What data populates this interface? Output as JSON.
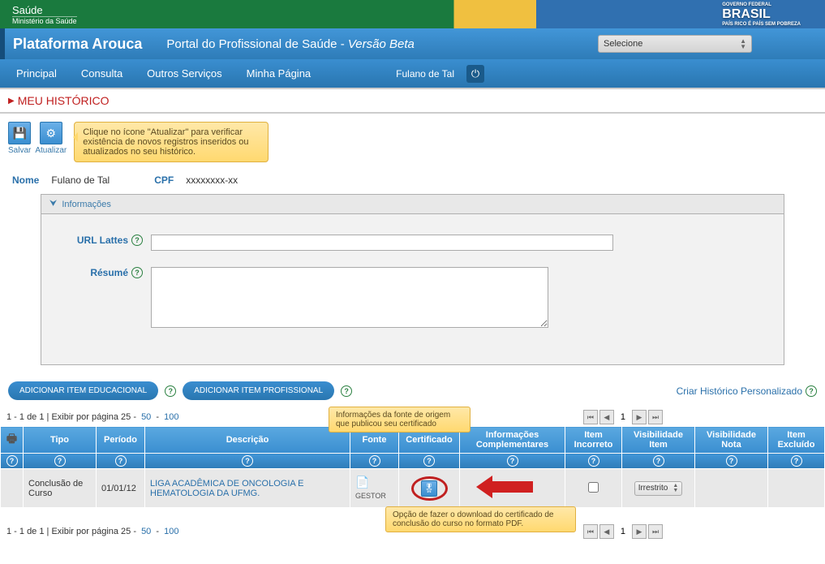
{
  "topbar": {
    "saude": "Saúde",
    "ministry": "Ministério da Saúde",
    "brasil": "BRASIL",
    "brasil_sub1": "GOVERNO FEDERAL",
    "brasil_sub2": "PAÍS RICO É PAÍS SEM POBREZA"
  },
  "header": {
    "platform": "Plataforma Arouca",
    "portal": "Portal do Profissional de Saúde - ",
    "beta": "Versão Beta",
    "selecione": "Selecione"
  },
  "nav": {
    "principal": "Principal",
    "consulta": "Consulta",
    "outros": "Outros Serviços",
    "minha": "Minha Página",
    "username": "Fulano de Tal"
  },
  "page": {
    "title": "MEU HISTÓRICO"
  },
  "toolbar": {
    "salvar": "Salvar",
    "atualizar": "Atualizar",
    "tooltip": "Clique no ícone \"Atualizar\" para verificar existência de novos registros inseridos ou  atualizados no seu histórico."
  },
  "info": {
    "nome_label": "Nome",
    "nome_value": "Fulano de Tal",
    "cpf_label": "CPF",
    "cpf_value": "xxxxxxxx-xx",
    "panel_title": "Informações",
    "url_lattes": "URL Lattes",
    "resume": "Résumé"
  },
  "actions": {
    "educacional": "ADICIONAR ITEM EDUCACIONAL",
    "profissional": "ADICIONAR ITEM PROFISSIONAL",
    "criar_historico": "Criar Histórico Personalizado"
  },
  "pagination": {
    "text": "1 - 1 de 1 | Exibir por página 25 - ",
    "opt50": "50",
    "dash": " - ",
    "opt100": "100",
    "current": "1"
  },
  "tooltips": {
    "fonte": "Informações da fonte de origem que publicou seu certificado",
    "cert": "Opção de fazer o download do certificado de conclusão do curso no formato PDF."
  },
  "table": {
    "headers": {
      "tipo": "Tipo",
      "periodo": "Período",
      "descricao": "Descrição",
      "fonte": "Fonte",
      "certificado": "Certificado",
      "info_comp": "Informações Complementares",
      "item_incorreto": "Item Incorreto",
      "vis_item": "Visibilidade Item",
      "vis_nota": "Visibilidade Nota",
      "item_excluido": "Item Excluído"
    },
    "row": {
      "tipo": "Conclusão de Curso",
      "periodo": "01/01/12",
      "descricao": "LIGA ACADÊMICA DE ONCOLOGIA E HEMATOLOGIA DA UFMG.",
      "fonte": "GESTOR",
      "visibilidade": "Irrestrito"
    }
  }
}
